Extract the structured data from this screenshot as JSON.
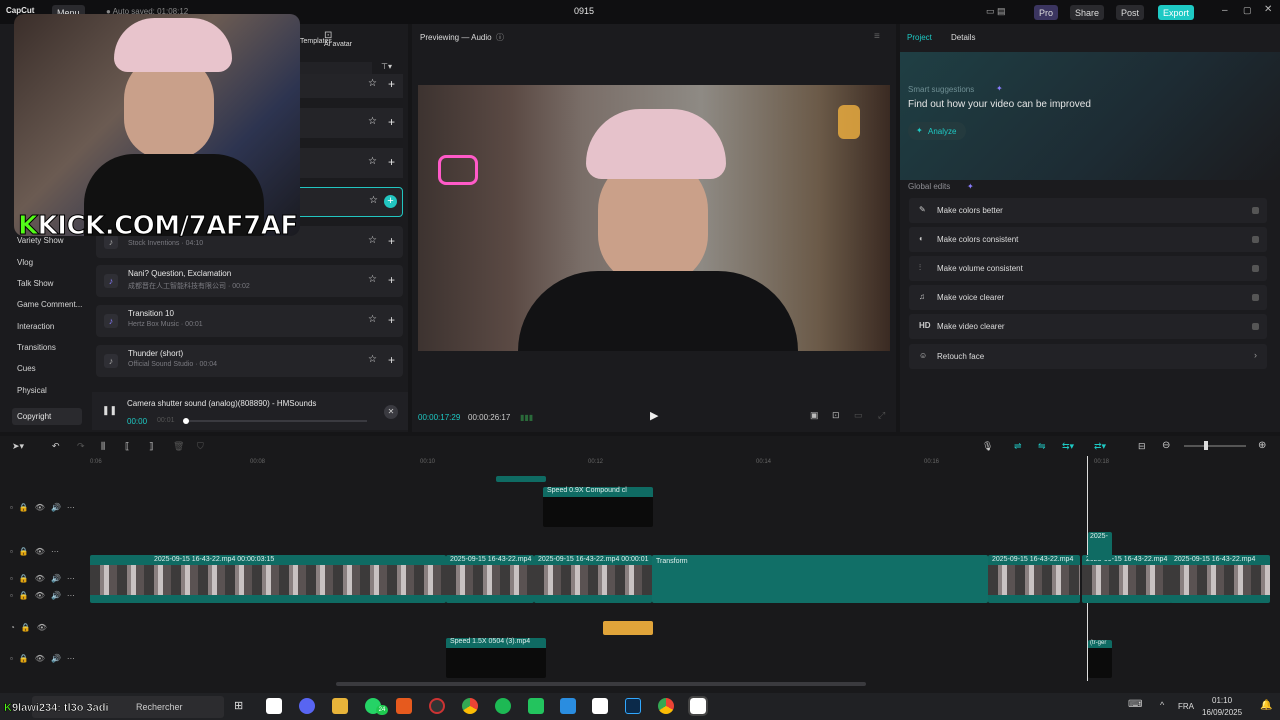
{
  "titlebar": {
    "logo": "CapCut",
    "menu": "Menu",
    "autosave": "Auto saved: 01:08:12",
    "project_title": "0915",
    "pro": "Pro",
    "share": "Share",
    "post": "Post",
    "export": "Export"
  },
  "left_panel": {
    "tabs": [
      "Templates",
      "AI avatar"
    ],
    "categories": [
      "Variety Show",
      "Vlog",
      "Talk Show",
      "Game Comment...",
      "Interaction",
      "Transitions",
      "Cues",
      "Physical",
      "Copyright"
    ],
    "sounds": [
      {
        "title": "",
        "sub": "Stock Inventions · 04:10"
      },
      {
        "title": "Nani? Question, Exclamation",
        "sub": "成都晋在人工智能科技有限公司 · 00:02"
      },
      {
        "title": "Transition 10",
        "sub": "Hertz Box Music · 00:01"
      },
      {
        "title": "Thunder (short)",
        "sub": "Official Sound Studio · 00:04"
      }
    ],
    "player": {
      "title": "Camera shutter sound (analog)(808890) - HMSounds",
      "time": "00:00",
      "total": "00:01"
    }
  },
  "overlay": {
    "kick_url": "KICK.COM/7AF7AF"
  },
  "preview": {
    "title": "Previewing — Audio",
    "current_time": "00:00:17:29",
    "total_time": "00:00:26:17"
  },
  "right_panel": {
    "tabs": [
      "Project",
      "Details"
    ],
    "smart_title": "Smart suggestions",
    "smart_heading": "Find out how your video can be improved",
    "analyze": "Analyze",
    "global_title": "Global edits",
    "global_edits": [
      "Make colors better",
      "Make colors consistent",
      "Make volume consistent",
      "Make voice clearer",
      "Make video clearer",
      "Retouch face"
    ]
  },
  "timeline": {
    "ticks": [
      "0:06",
      "00:08",
      "00:10",
      "00:12",
      "00:14",
      "00:16",
      "00:18"
    ],
    "clips": {
      "speed_compound": "Speed 0.9X  Compound cl",
      "main1": "2025-09-15 16-43-22.mp4  00:00:03:15",
      "main2": "2025-09-15 16-43-22.mp4",
      "main3": "2025-09-15 16-43-22.mp4  00:00:01",
      "transform": "Transform",
      "main4": "2025-09-15 16-43-22.mp4",
      "main5": "2025-09-15 16-43-22.mp4",
      "main6": "2025-09-15 16-43-22.mp4",
      "small": "2025-",
      "speed2": "Speed 1.5X  0504 (3).mp4",
      "tail": "(tr-ger"
    }
  },
  "taskbar": {
    "search": "Rechercher",
    "overlay_text": "9lawi234: tl3o 3adi",
    "badge": "24",
    "lang": "FRA",
    "time": "01:10",
    "date": "16/09/2025"
  }
}
